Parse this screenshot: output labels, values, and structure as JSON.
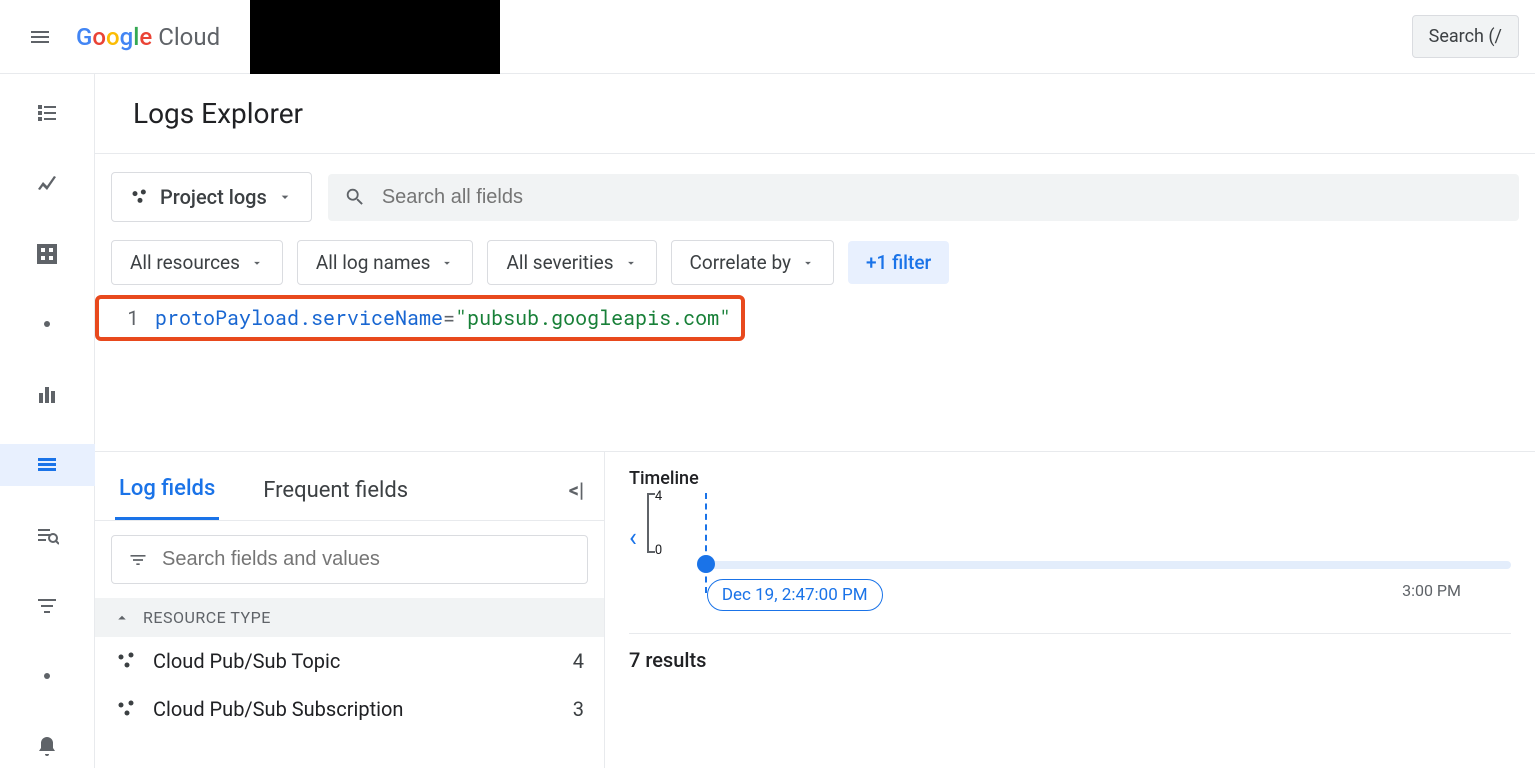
{
  "header": {
    "product": "Cloud",
    "search_label": "Search (/"
  },
  "page": {
    "title": "Logs Explorer"
  },
  "scope": {
    "label": "Project logs"
  },
  "search": {
    "placeholder": "Search all fields"
  },
  "chips": {
    "resources": "All resources",
    "lognames": "All log names",
    "severities": "All severities",
    "correlate": "Correlate by",
    "add_filter": "+1 filter"
  },
  "query": {
    "line_no": "1",
    "key": "protoPayload.serviceName",
    "op": "=",
    "value": "\"pubsub.googleapis.com\""
  },
  "tabs": {
    "log_fields": "Log fields",
    "frequent": "Frequent fields"
  },
  "fields": {
    "search_placeholder": "Search fields and values",
    "section": "RESOURCE TYPE",
    "items": [
      {
        "label": "Cloud Pub/Sub Topic",
        "count": "4"
      },
      {
        "label": "Cloud Pub/Sub Subscription",
        "count": "3"
      }
    ]
  },
  "timeline": {
    "title": "Timeline",
    "ymax": "4",
    "ymin": "0",
    "badge": "Dec 19, 2:47:00 PM",
    "tick2": "3:00 PM"
  },
  "results": {
    "summary": "7 results"
  }
}
